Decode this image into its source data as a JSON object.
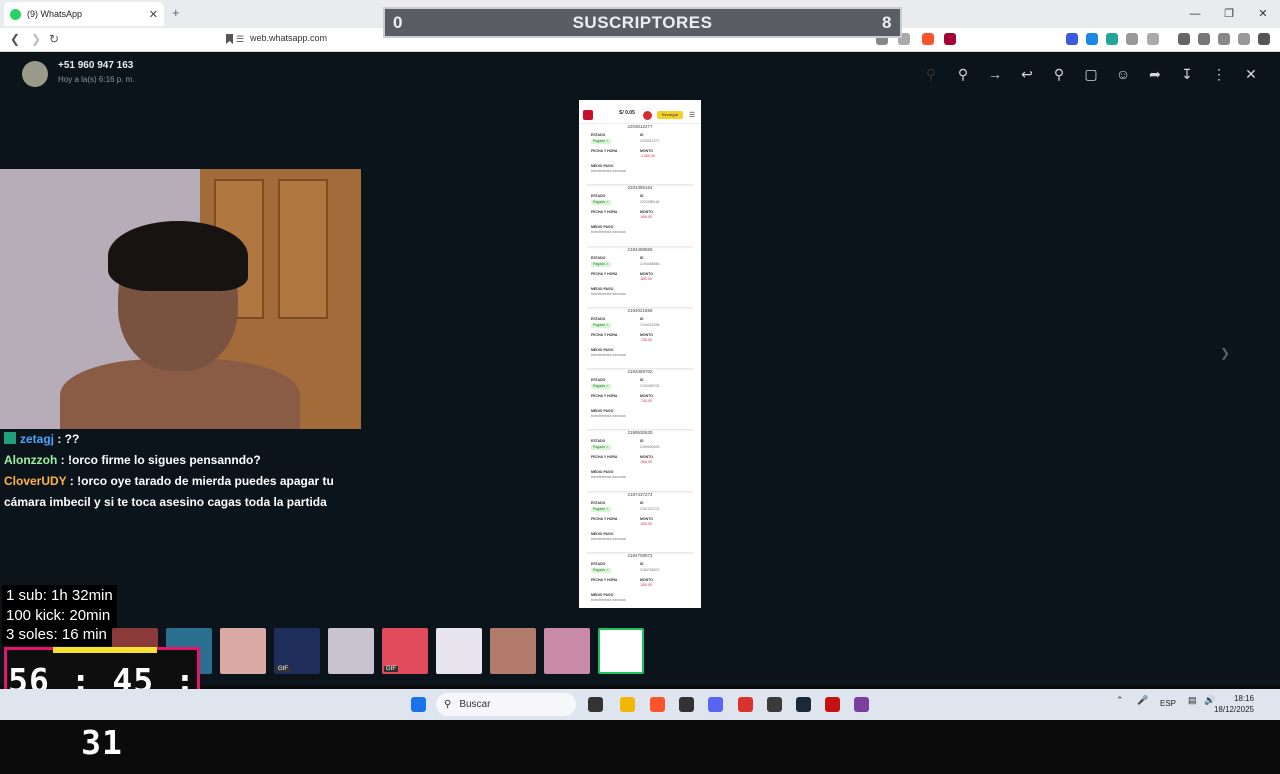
{
  "browser": {
    "tab_title": "(9) WhatsApp",
    "tab_close": "✕",
    "new_tab": "+",
    "url": "web.whatsapp.com",
    "win_min": "—",
    "win_restore": "❐",
    "win_close": "✕"
  },
  "overlay": {
    "left_count": "0",
    "label": "SUSCRIPTORES",
    "right_count": "8"
  },
  "viewer": {
    "sender": "+51 960 947 163",
    "time": "Hoy a la(s) 6:16 p. m."
  },
  "screenshot": {
    "balance": "S/ 0.05",
    "recharge": "Recargar",
    "cards": [
      {
        "id": "2203012277",
        "amount": "-1,000.00"
      },
      {
        "id": "2202385164",
        "amount": "-900.00"
      },
      {
        "id": "2194488566",
        "amount": "-800.00"
      },
      {
        "id": "2194021556",
        "amount": "-700.00"
      },
      {
        "id": "2193469702",
        "amount": "-700.00"
      },
      {
        "id": "2189530630",
        "amount": "-900.00"
      },
      {
        "id": "2187437274",
        "amount": "-600.00"
      },
      {
        "id": "2184708872",
        "amount": "-300.00"
      }
    ],
    "labels": {
      "estado": "ESTADO",
      "pagado": "Pagado ✓",
      "id": "ID",
      "fecha": "FECHA Y HORA",
      "monto": "MONTO",
      "medio": "MEDIO PAGO",
      "medio_val": "transferencia bancaria"
    }
  },
  "chat": [
    {
      "user": "zetagj",
      "text": " : ??",
      "badge": true,
      "color": "#4fa3ff"
    },
    {
      "user": "Alonzzoh",
      "text": " : !orco firme lo sigues pensanndo?",
      "badge": false,
      "color": "#9ef0a4"
    },
    {
      "user": "CloverUDY",
      "text": " : !orco oye tarado de mierda puedes apagar tu cámara imbecil y si te toca asesino cagas toda la partida",
      "badge": false,
      "color": "#ffb347"
    }
  ],
  "goals": {
    "line1": "1 sub: 1h 32min",
    "line2": "100 kick: 20min",
    "line3": "3 soles: 16 min"
  },
  "timer": {
    "value": "56 : 45 : 31"
  },
  "taskbar": {
    "search": "Buscar",
    "lang": "ESP",
    "time": "18:16",
    "date": "18/12/2025"
  },
  "colors": {
    "overlay_bg": "#5a5e64",
    "timer_border": "#e4166b",
    "timer_accent": "#f5e131",
    "thumb_selected": "#21c063"
  }
}
